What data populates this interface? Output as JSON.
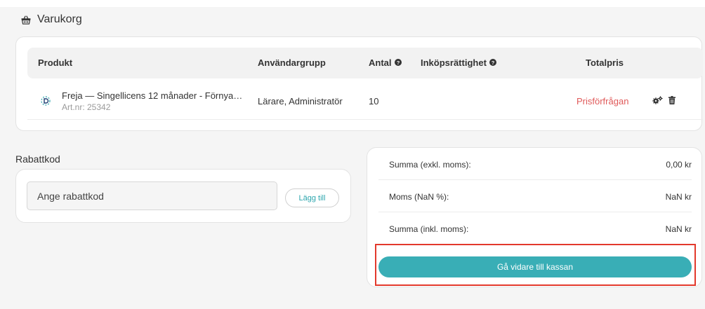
{
  "header": {
    "title": "Varukorg",
    "icon": "basket-icon"
  },
  "cart": {
    "columns": {
      "product": "Produkt",
      "user_group": "Användargrupp",
      "quantity": "Antal",
      "purchase_right": "Inköpsrättighet",
      "total_price": "Totalpris"
    },
    "items": [
      {
        "name": "Freja — Singellicens 12 månader - Förnyas automa...",
        "article": "Art.nr: 25342",
        "user_group": "Lärare, Administratör",
        "quantity": "10",
        "total_price": "Prisförfrågan",
        "icons": [
          "settings-icon",
          "trash-icon"
        ]
      }
    ]
  },
  "discount": {
    "label": "Rabattkod",
    "placeholder": "Ange rabattkod",
    "button_label": "Lägg till"
  },
  "summary": {
    "rows": [
      {
        "label": "Summa (exkl. moms):",
        "value": "0,00 kr"
      },
      {
        "label": "Moms (NaN %):",
        "value": "NaN kr"
      },
      {
        "label": "Summa (inkl. moms):",
        "value": "NaN kr"
      }
    ],
    "checkout_label": "Gå vidare till kassan"
  },
  "colors": {
    "accent": "#39aeb6",
    "price_request": "#e05a5a",
    "highlight": "#e3392c"
  }
}
